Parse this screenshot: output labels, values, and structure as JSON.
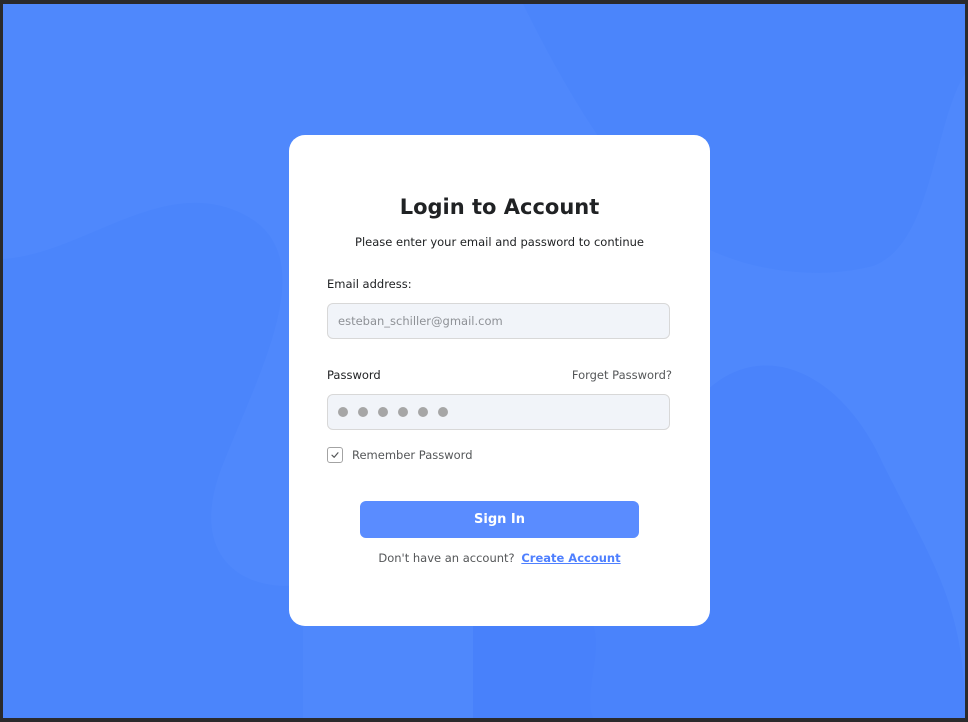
{
  "colors": {
    "background": "#4f88fc",
    "background_shape": "#4a84fb",
    "card": "#ffffff",
    "primary": "#5a8cff",
    "link": "#4f80ff",
    "field_background": "#f1f4f9"
  },
  "login": {
    "title": "Login to Account",
    "subtitle": "Please enter your email and password to continue",
    "email_label": "Email address:",
    "email_value": "esteban_schiller@gmail.com",
    "password_label": "Password",
    "forgot_link": "Forget Password?",
    "password_masked_length": 6,
    "remember_label": "Remember Password",
    "remember_checked": true,
    "signin_label": "Sign In",
    "no_account_text": "Don't have an account?",
    "create_account_link": "Create Account"
  },
  "icons": {
    "checkbox": "check-icon",
    "password_dot": "password-dot-icon"
  }
}
